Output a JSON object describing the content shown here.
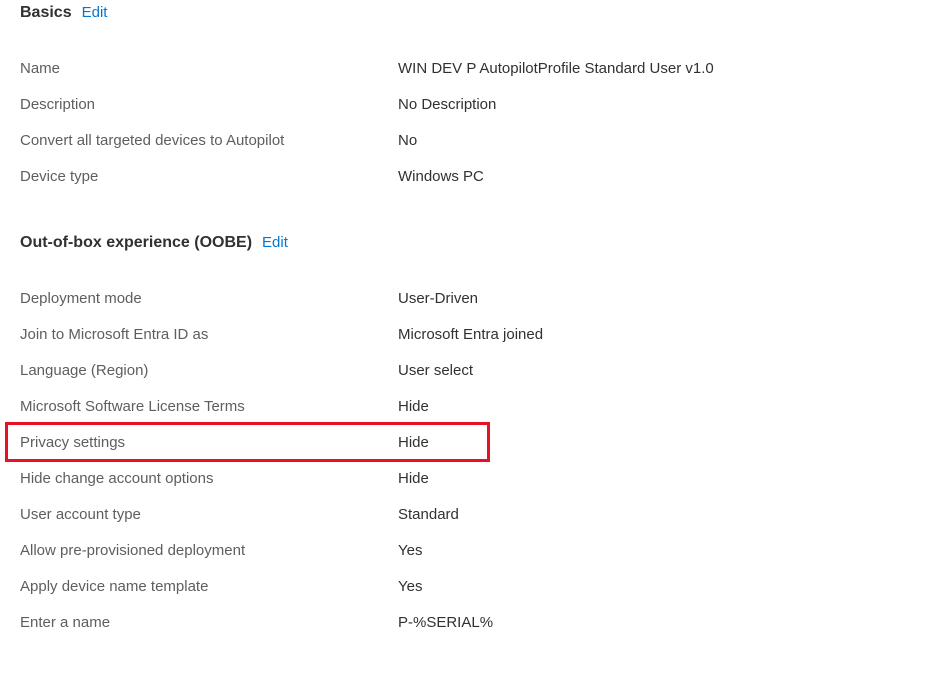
{
  "basics": {
    "title": "Basics",
    "edit": "Edit",
    "rows": [
      {
        "label": "Name",
        "value": "WIN DEV P AutopilotProfile Standard User v1.0"
      },
      {
        "label": "Description",
        "value": "No Description"
      },
      {
        "label": "Convert all targeted devices to Autopilot",
        "value": "No"
      },
      {
        "label": "Device type",
        "value": "Windows PC"
      }
    ]
  },
  "oobe": {
    "title": "Out-of-box experience (OOBE)",
    "edit": "Edit",
    "rows": [
      {
        "label": "Deployment mode",
        "value": "User-Driven"
      },
      {
        "label": "Join to Microsoft Entra ID as",
        "value": "Microsoft Entra joined"
      },
      {
        "label": "Language (Region)",
        "value": "User select"
      },
      {
        "label": "Microsoft Software License Terms",
        "value": "Hide"
      },
      {
        "label": "Privacy settings",
        "value": "Hide"
      },
      {
        "label": "Hide change account options",
        "value": "Hide"
      },
      {
        "label": "User account type",
        "value": "Standard"
      },
      {
        "label": "Allow pre-provisioned deployment",
        "value": "Yes"
      },
      {
        "label": "Apply device name template",
        "value": "Yes"
      },
      {
        "label": "Enter a name",
        "value": "P-%SERIAL%"
      }
    ]
  }
}
